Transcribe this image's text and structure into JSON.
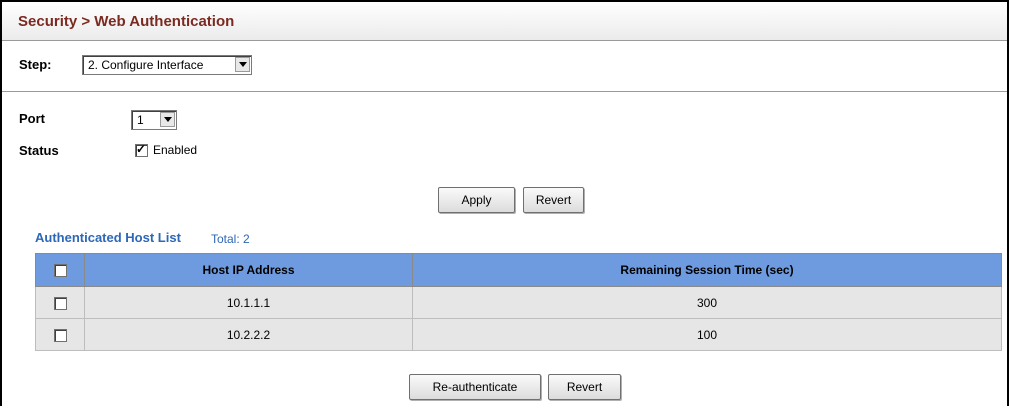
{
  "header": {
    "title": "Security > Web Authentication"
  },
  "step": {
    "label": "Step:",
    "selected": "2. Configure Interface"
  },
  "form": {
    "port_label": "Port",
    "port_value": "1",
    "status_label": "Status",
    "status_checkbox_label": "Enabled",
    "status_checked": true
  },
  "form_buttons": {
    "apply": "Apply",
    "revert": "Revert"
  },
  "host_list": {
    "title": "Authenticated Host List",
    "total": "Total: 2",
    "columns": [
      "Host IP Address",
      "Remaining Session Time (sec)"
    ],
    "rows": [
      {
        "ip": "10.1.1.1",
        "time": "300"
      },
      {
        "ip": "10.2.2.2",
        "time": "100"
      }
    ]
  },
  "list_buttons": {
    "reauthenticate": "Re-authenticate",
    "revert": "Revert"
  }
}
